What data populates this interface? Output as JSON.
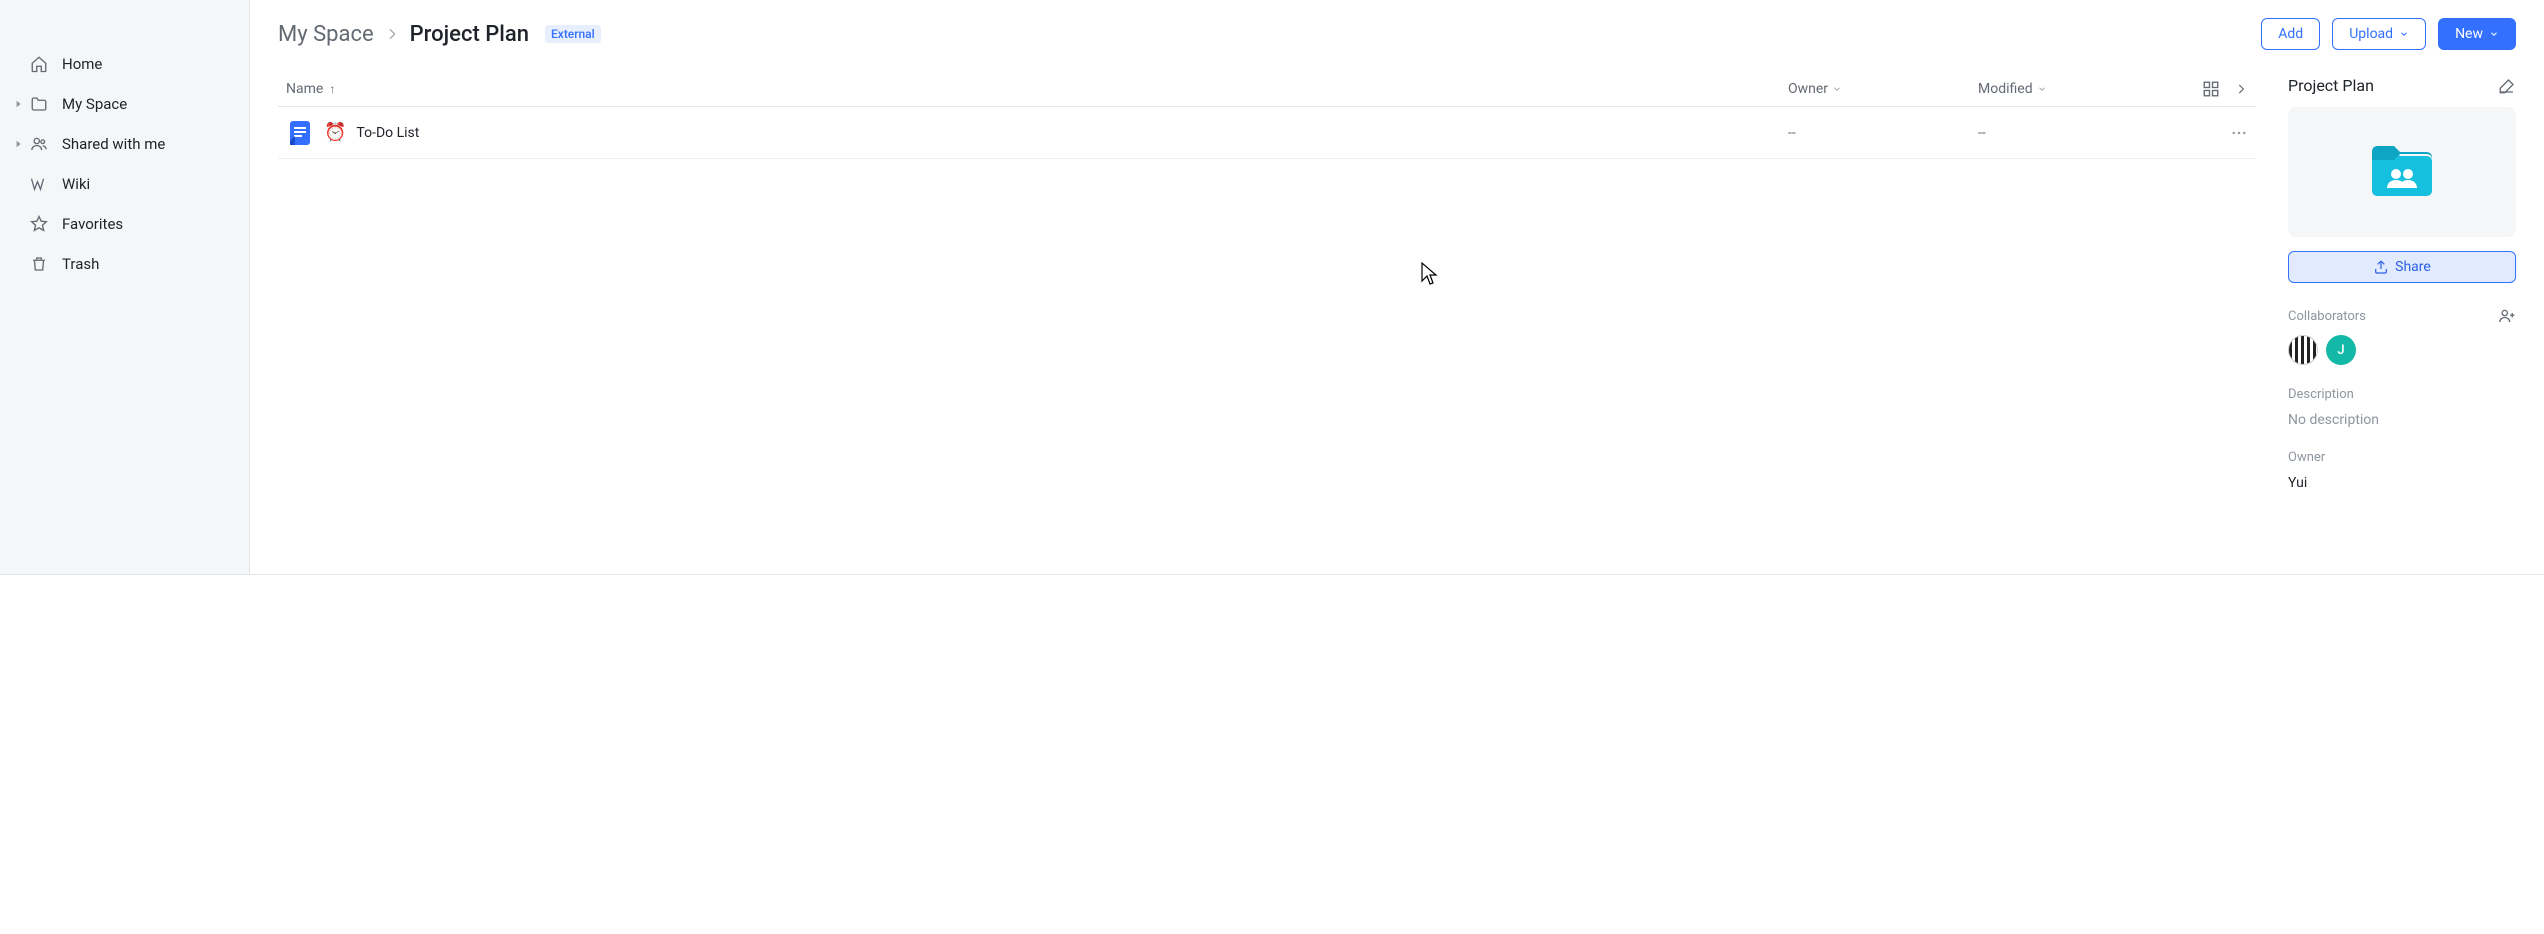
{
  "sidebar": {
    "items": [
      {
        "label": "Home",
        "has_caret": false,
        "icon": "home"
      },
      {
        "label": "My Space",
        "has_caret": true,
        "icon": "folder"
      },
      {
        "label": "Shared with me",
        "has_caret": true,
        "icon": "people"
      },
      {
        "label": "Wiki",
        "has_caret": false,
        "icon": "wiki"
      },
      {
        "label": "Favorites",
        "has_caret": false,
        "icon": "star"
      },
      {
        "label": "Trash",
        "has_caret": false,
        "icon": "trash"
      }
    ]
  },
  "breadcrumb": {
    "root": "My Space",
    "current": "Project Plan",
    "badge": "External"
  },
  "actions": {
    "add": "Add",
    "upload": "Upload",
    "new": "New"
  },
  "list": {
    "headers": {
      "name": "Name",
      "owner": "Owner",
      "modified": "Modified"
    },
    "rows": [
      {
        "name": "To-Do List",
        "owner": "--",
        "modified": "--"
      }
    ]
  },
  "detail": {
    "title": "Project Plan",
    "share": "Share",
    "collaborators_label": "Collaborators",
    "collaborators": [
      {
        "initial": "",
        "style": "striped"
      },
      {
        "initial": "J",
        "style": "green"
      }
    ],
    "description_label": "Description",
    "description_value": "No description",
    "owner_label": "Owner",
    "owner_value": "Yui"
  }
}
